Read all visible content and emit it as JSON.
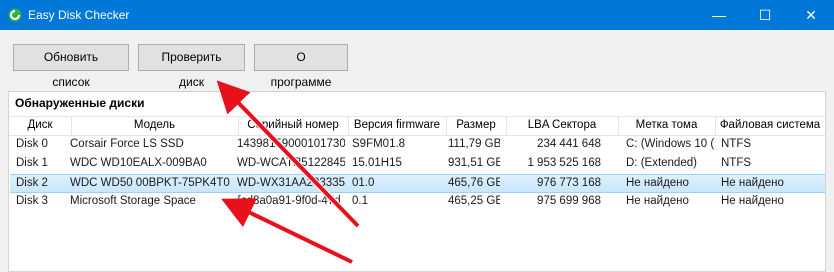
{
  "window": {
    "title": "Easy Disk Checker",
    "min_glyph": "—",
    "max_glyph": "☐",
    "close_glyph": "✕"
  },
  "toolbar": {
    "refresh_label": "Обновить список",
    "check_label": "Проверить диск",
    "about_label": "О программе"
  },
  "group": {
    "title": "Обнаруженные диски"
  },
  "table": {
    "headers": [
      "Диск",
      "Модель",
      "Серийный номер",
      "Версия firmware",
      "Размер",
      "LBA Сектора",
      "Метка тома",
      "Файловая система"
    ],
    "rows": [
      [
        "Disk 0",
        "Corsair Force LS SSD",
        "14398159000101730",
        "S9FM01.8",
        "111,79 GB",
        "234 441 648",
        "C: (Windows 10 (",
        "NTFS"
      ],
      [
        "Disk 1",
        "WDC WD10EALX-009BA0",
        "WD-WCATR5122845",
        "15.01H15",
        "931,51 GB",
        "1 953 525 168",
        "D: (Extended)",
        "NTFS"
      ],
      [
        "Disk 2",
        "WDC WD50 00BPKT-75PK4T0",
        "WD-WX31AA293335",
        "01.0",
        "465,76 GB",
        "976 773 168",
        "Не найдено",
        "Не найдено"
      ],
      [
        "Disk 3",
        "Microsoft Storage Space",
        "{cd8a0a91-9f0d-47d",
        "0.1",
        "465,25 GB",
        "975 699 968",
        "Не найдено",
        "Не найдено"
      ]
    ],
    "selected_row": 2
  },
  "colors": {
    "titlebar": "#0078d7",
    "arrow": "#e8101a",
    "selection": "#cce8ff"
  },
  "icons": {
    "app": "app-icon-green-disk"
  }
}
